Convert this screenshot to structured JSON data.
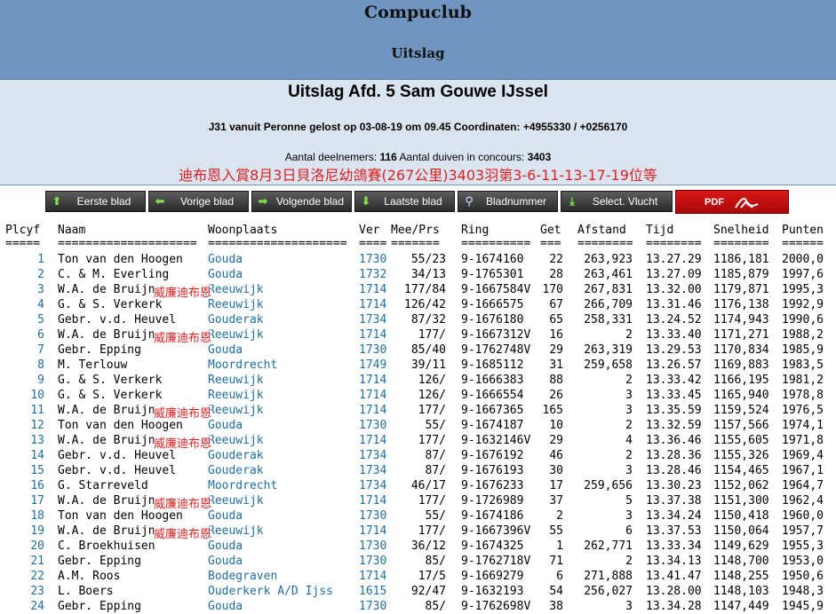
{
  "site": {
    "title": "Compuclub",
    "subtitle": "Uitslag"
  },
  "header": {
    "title": "Uitslag Afd. 5 Sam Gouwe IJssel",
    "race_info": "J31 vanuit Peronne gelost op 03-08-19 om 09.45 Coordinaten: +4955330 / +0256170",
    "participants_label": "Aantal deelnemers: ",
    "participants_value": "116",
    "pigeons_label": " Aantal duiven in concours: ",
    "pigeons_value": "3403",
    "overlay_text": "迪布恩入賞8月3日貝洛尼幼鴿賽(267公里)3403羽第3-6-11-13-17-19位等"
  },
  "nav": {
    "first": "Eerste blad",
    "prev": "Vorige blad",
    "next": "Volgende blad",
    "last": "Laatste blad",
    "page_number": "Bladnummer",
    "select_flight": "Select. Vlucht",
    "pdf": "PDF"
  },
  "colors": {
    "banner": "#6f95c0",
    "subheader": "#dbe5f1",
    "link_blue": "#1f6fa0",
    "overlay_red": "#e02020",
    "pdf_red": "#c81010"
  },
  "table": {
    "columns": [
      "Plcyf",
      "Naam",
      "Woonplaats",
      "Ver",
      "Mee/Prs",
      "Ring",
      "Get",
      "Afstand",
      "Tijd",
      "Snelheid",
      "Punten"
    ],
    "separators": [
      "=====",
      "====================",
      "====================",
      "====",
      "=======",
      "==========",
      "===",
      "========",
      "========",
      "========",
      "======"
    ],
    "overlay_label": "威廉迪布恩",
    "rows": [
      [
        "1",
        "Ton van den Hoogen",
        "Gouda",
        "1730",
        "55/23",
        "9-1674160",
        "22",
        "263,923",
        "13.27.29",
        "1186,181",
        "2000,0"
      ],
      [
        "2",
        "C. & M. Everling",
        "Gouda",
        "1732",
        "34/13",
        "9-1765301",
        "28",
        "263,461",
        "13.27.09",
        "1185,879",
        "1997,6"
      ],
      [
        "3",
        "W.A. de Bruijn",
        "Reeuwijk",
        "1714",
        "177/84",
        "9-1667584V",
        "170",
        "267,831",
        "13.32.00",
        "1179,871",
        "1995,3"
      ],
      [
        "4",
        "G. & S. Verkerk",
        "Reeuwijk",
        "1714",
        "126/42",
        "9-1666575",
        "67",
        "266,709",
        "13.31.46",
        "1176,138",
        "1992,9"
      ],
      [
        "5",
        "Gebr. v.d. Heuvel",
        "Gouderak",
        "1734",
        "87/32",
        "9-1676180",
        "65",
        "258,331",
        "13.24.52",
        "1174,943",
        "1990,6"
      ],
      [
        "6",
        "W.A. de Bruijn",
        "Reeuwijk",
        "1714",
        "177/",
        "9-1667312V",
        "16",
        "2",
        "13.33.40",
        "1171,271",
        "1988,2"
      ],
      [
        "7",
        "Gebr. Epping",
        "Gouda",
        "1730",
        "85/40",
        "9-1762748V",
        "29",
        "263,319",
        "13.29.53",
        "1170,834",
        "1985,9"
      ],
      [
        "8",
        "M. Terlouw",
        "Moordrecht",
        "1749",
        "39/11",
        "9-1685112",
        "31",
        "259,658",
        "13.26.57",
        "1169,883",
        "1983,5"
      ],
      [
        "9",
        "G. & S. Verkerk",
        "Reeuwijk",
        "1714",
        "126/",
        "9-1666383",
        "88",
        "2",
        "13.33.42",
        "1166,195",
        "1981,2"
      ],
      [
        "10",
        "G. & S. Verkerk",
        "Reeuwijk",
        "1714",
        "126/",
        "9-1666554",
        "26",
        "3",
        "13.33.45",
        "1165,940",
        "1978,8"
      ],
      [
        "11",
        "W.A. de Bruijn",
        "Reeuwijk",
        "1714",
        "177/",
        "9-1667365",
        "165",
        "3",
        "13.35.59",
        "1159,524",
        "1976,5"
      ],
      [
        "12",
        "Ton van den Hoogen",
        "Gouda",
        "1730",
        "55/",
        "9-1674187",
        "10",
        "2",
        "13.32.59",
        "1157,566",
        "1974,1"
      ],
      [
        "13",
        "W.A. de Bruijn",
        "Reeuwijk",
        "1714",
        "177/",
        "9-1632146V",
        "29",
        "4",
        "13.36.46",
        "1155,605",
        "1971,8"
      ],
      [
        "14",
        "Gebr. v.d. Heuvel",
        "Gouderak",
        "1734",
        "87/",
        "9-1676192",
        "46",
        "2",
        "13.28.36",
        "1155,326",
        "1969,4"
      ],
      [
        "15",
        "Gebr. v.d. Heuvel",
        "Gouderak",
        "1734",
        "87/",
        "9-1676193",
        "30",
        "3",
        "13.28.46",
        "1154,465",
        "1967,1"
      ],
      [
        "16",
        "G. Starreveld",
        "Moordrecht",
        "1734",
        "46/17",
        "9-1676233",
        "17",
        "259,656",
        "13.30.23",
        "1152,062",
        "1964,7"
      ],
      [
        "17",
        "W.A. de Bruijn",
        "Reeuwijk",
        "1714",
        "177/",
        "9-1726989",
        "37",
        "5",
        "13.37.38",
        "1151,300",
        "1962,4"
      ],
      [
        "18",
        "Ton van den Hoogen",
        "Gouda",
        "1730",
        "55/",
        "9-1674186",
        "2",
        "3",
        "13.34.24",
        "1150,418",
        "1960,0"
      ],
      [
        "19",
        "W.A. de Bruijn",
        "Reeuwijk",
        "1714",
        "177/",
        "9-1667396V",
        "55",
        "6",
        "13.37.53",
        "1150,064",
        "1957,7"
      ],
      [
        "20",
        "C. Broekhuisen",
        "Gouda",
        "1730",
        "36/12",
        "9-1674325",
        "1",
        "262,771",
        "13.33.34",
        "1149,629",
        "1955,3"
      ],
      [
        "21",
        "Gebr. Epping",
        "Gouda",
        "1730",
        "85/",
        "9-1762718V",
        "71",
        "2",
        "13.34.13",
        "1148,700",
        "1953,0"
      ],
      [
        "22",
        "A.M. Roos",
        "Bodegraven",
        "1714",
        "17/5",
        "9-1669279",
        "6",
        "271,888",
        "13.41.47",
        "1148,255",
        "1950,6"
      ],
      [
        "23",
        "L. Boers",
        "Ouderkerk A/D Ijss",
        "1615",
        "92/47",
        "9-1632193",
        "54",
        "256,027",
        "13.28.00",
        "1148,103",
        "1948,3"
      ],
      [
        "24",
        "Gebr. Epping",
        "Gouda",
        "1730",
        "85/",
        "9-1762698V",
        "38",
        "3",
        "13.34.28",
        "1147,449",
        "1945,9"
      ]
    ]
  }
}
